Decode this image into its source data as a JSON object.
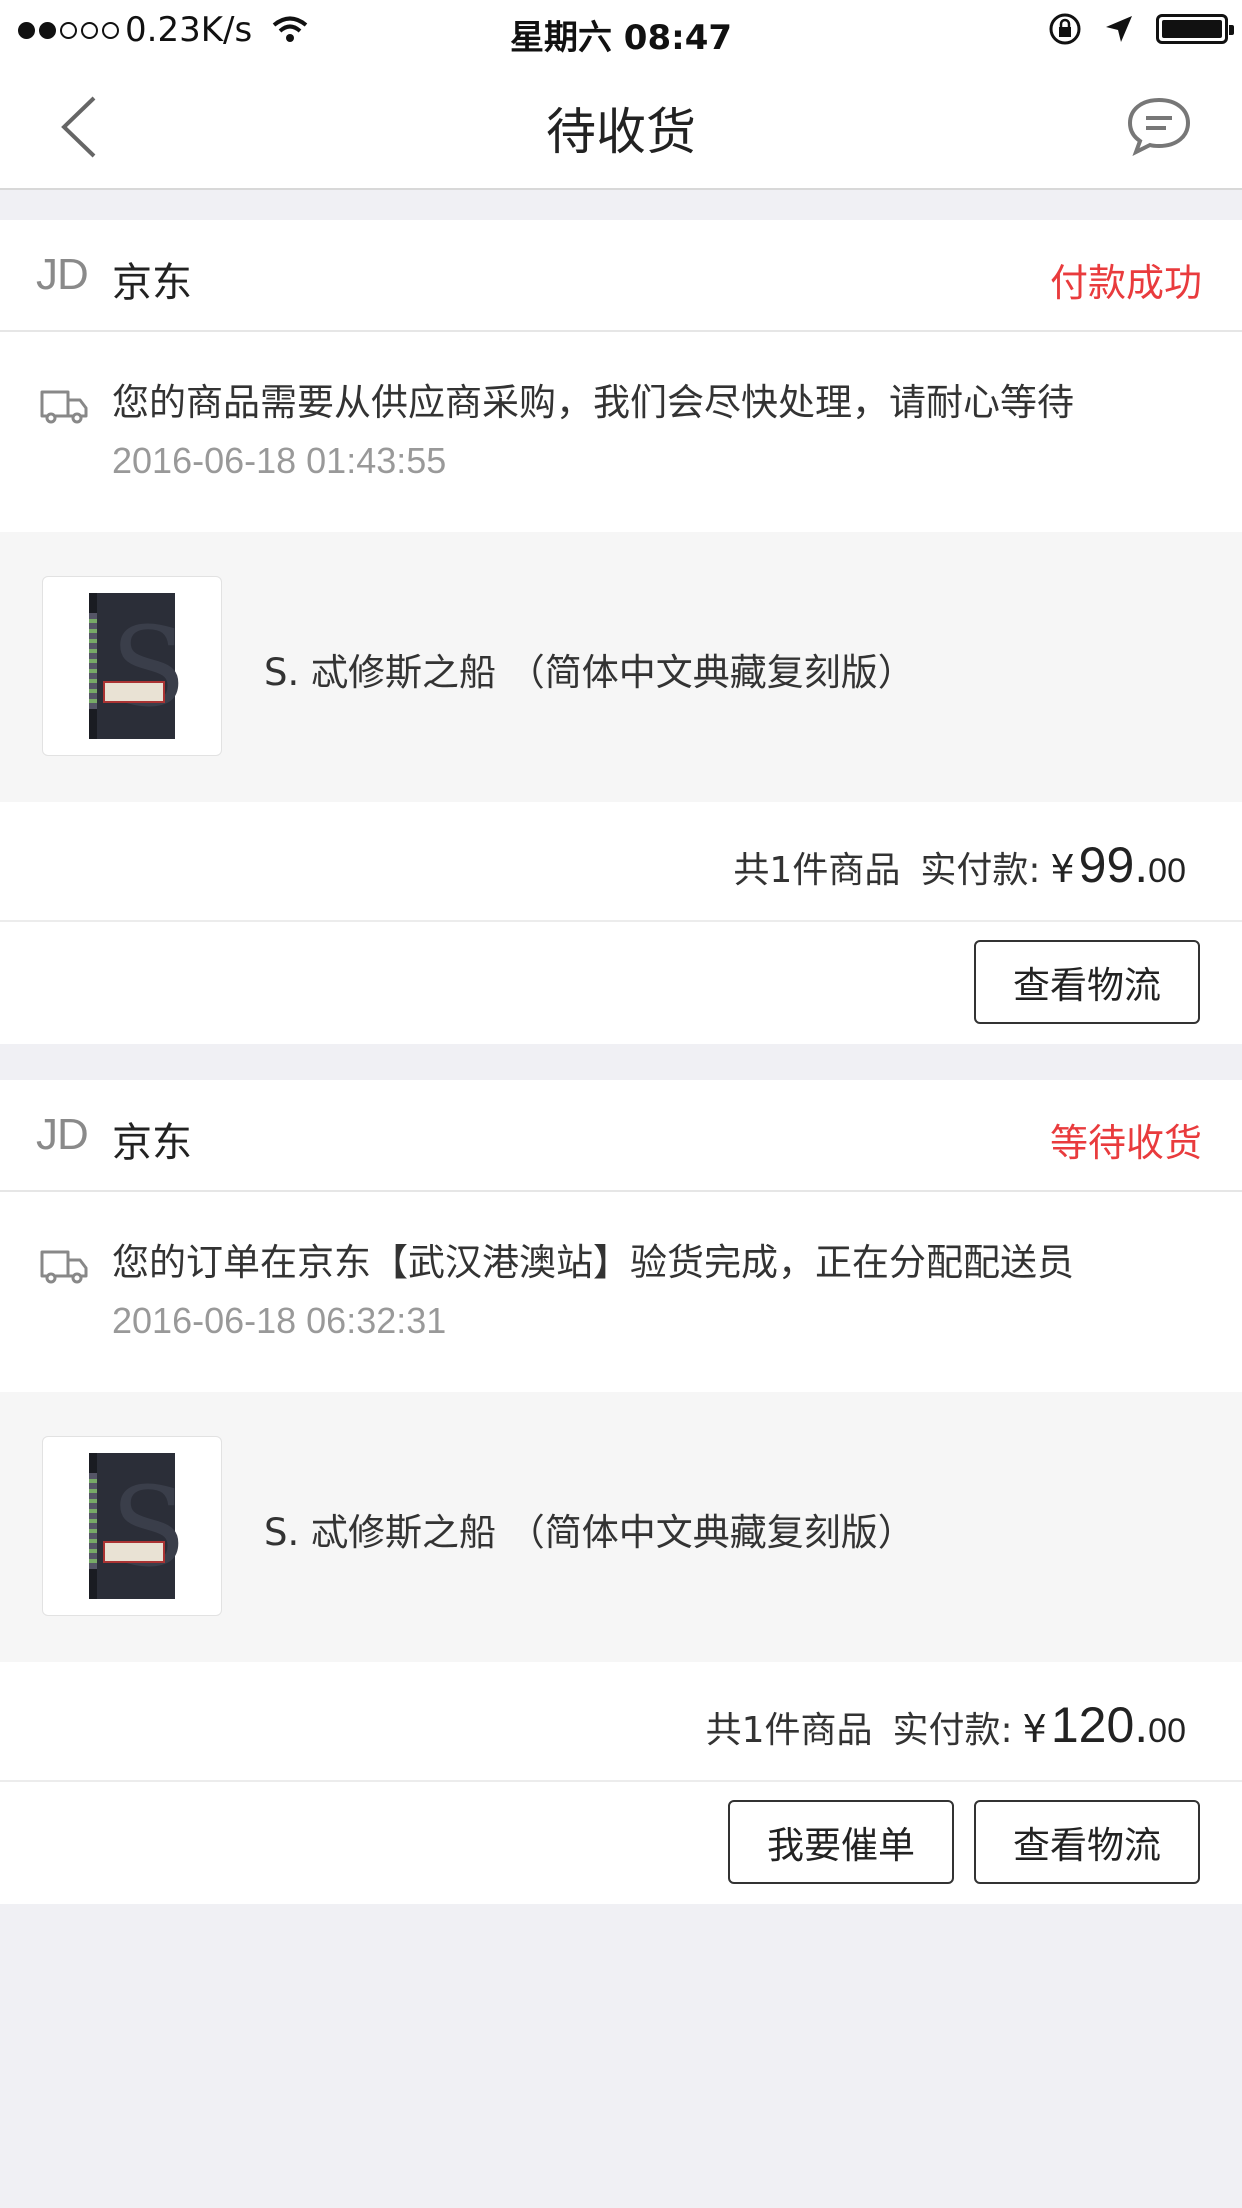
{
  "status_bar": {
    "network": "0.23K/s",
    "time": "星期六 08:47"
  },
  "nav": {
    "title": "待收货"
  },
  "orders": [
    {
      "shop_logo": "JD",
      "shop_name": "京东",
      "status": "付款成功",
      "tracking_message": "您的商品需要从供应商采购，我们会尽快处理，请耐心等待",
      "tracking_time": "2016-06-18 01:43:55",
      "product_name": "S. 忒修斯之船 （简体中文典藏复刻版）",
      "item_count_text": "共1件商品",
      "paid_label": "实付款:",
      "currency": "¥",
      "price_int": "99.",
      "price_dec": "00",
      "buttons": [
        "查看物流"
      ]
    },
    {
      "shop_logo": "JD",
      "shop_name": "京东",
      "status": "等待收货",
      "tracking_message": "您的订单在京东【武汉港澳站】验货完成，正在分配配送员",
      "tracking_time": "2016-06-18 06:32:31",
      "product_name": "S. 忒修斯之船 （简体中文典藏复刻版）",
      "item_count_text": "共1件商品",
      "paid_label": "实付款:",
      "currency": "¥",
      "price_int": "120.",
      "price_dec": "00",
      "buttons": [
        "我要催单",
        "查看物流"
      ]
    }
  ],
  "colors": {
    "status_red": "#e93b3d",
    "background": "#f0f0f4"
  }
}
